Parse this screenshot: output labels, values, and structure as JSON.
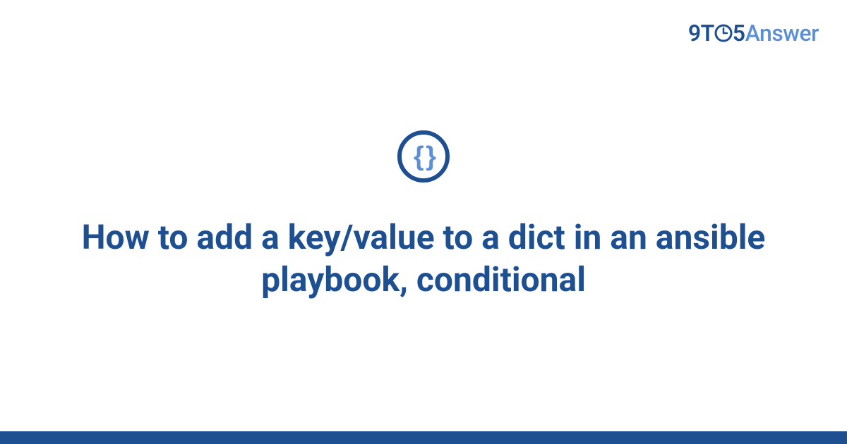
{
  "brand": {
    "part1": "9T",
    "part2": "5",
    "part3": "Answer"
  },
  "icon": {
    "glyph": "{ }",
    "name": "code-braces"
  },
  "main": {
    "title": "How to add a key/value to a dict in an ansible playbook, conditional"
  },
  "colors": {
    "primary": "#1d4f91",
    "accent": "#5b8fd6"
  }
}
